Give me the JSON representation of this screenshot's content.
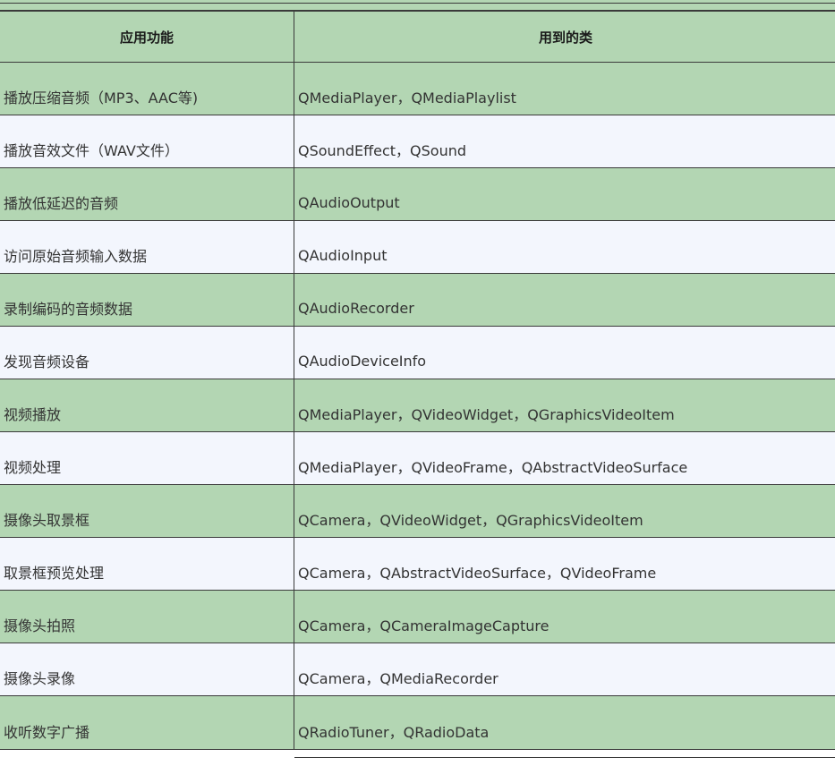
{
  "table": {
    "headers": [
      "应用功能",
      "用到的类"
    ],
    "rows": [
      [
        "播放压缩音频（MP3、AAC等)",
        "QMediaPlayer，QMediaPlaylist"
      ],
      [
        "播放音效文件（WAV文件）",
        "QSoundEffect，QSound"
      ],
      [
        "播放低延迟的音频",
        "QAudioOutput"
      ],
      [
        "访问原始音频输入数据",
        "QAudioInput"
      ],
      [
        "录制编码的音频数据",
        "QAudioRecorder"
      ],
      [
        "发现音频设备",
        "QAudioDeviceInfo"
      ],
      [
        "视频播放",
        "QMediaPlayer，QVideoWidget，QGraphicsVideoItem"
      ],
      [
        "视频处理",
        "QMediaPlayer，QVideoFrame，QAbstractVideoSurface"
      ],
      [
        "摄像头取景框",
        "QCamera，QVideoWidget，QGraphicsVideoItem"
      ],
      [
        "取景框预览处理",
        "QCamera，QAbstractVideoSurface，QVideoFrame"
      ],
      [
        "摄像头拍照",
        "QCamera，QCameraImageCapture"
      ],
      [
        "摄像头录像",
        "QCamera，QMediaRecorder"
      ],
      [
        "收听数字广播",
        "QRadioTuner，QRadioData"
      ]
    ]
  },
  "colors": {
    "green_row": "#b3d6b3",
    "light_row": "#f3f6fd",
    "border": "#3a3a3a",
    "text": "#333333"
  }
}
